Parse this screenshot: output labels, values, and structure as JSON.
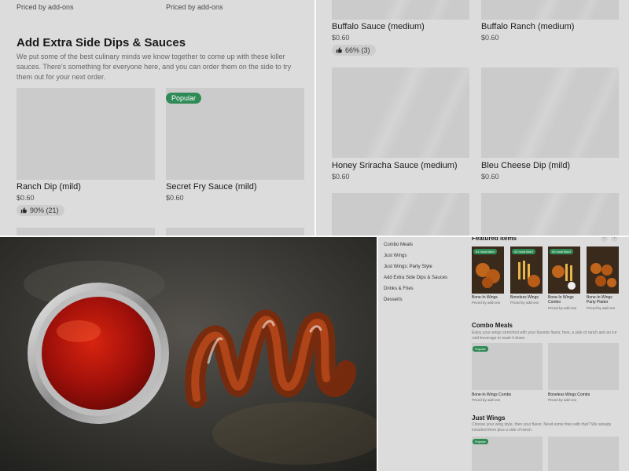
{
  "top_left": {
    "prev_items": [
      {
        "price": "Priced by add-ons"
      },
      {
        "price": "Priced by add-ons"
      }
    ],
    "section_title": "Add Extra Side Dips & Sauces",
    "section_desc": "We put some of the best culinary minds we know together to come up with these killer sauces. There's something for everyone here, and you can order them on the side to try them out for your next order.",
    "items": [
      {
        "name": "Ranch Dip (mild)",
        "price": "$0.60",
        "rating": "90% (21)"
      },
      {
        "name": "Secret Fry Sauce (mild)",
        "price": "$0.60",
        "badge": "Popular"
      }
    ]
  },
  "top_right": {
    "items": [
      {
        "name": "Buffalo Sauce (medium)",
        "price": "$0.60",
        "rating": "66% (3)"
      },
      {
        "name": "Buffalo Ranch (medium)",
        "price": "$0.60"
      },
      {
        "name": "Honey Sriracha Sauce (medium)",
        "price": "$0.60"
      },
      {
        "name": "Bleu Cheese Dip (mild)",
        "price": "$0.60"
      }
    ]
  },
  "bottom_left": {
    "photo_subject": "sauce-cup-photo"
  },
  "bottom_right": {
    "nav": [
      "Combo Meals",
      "Just Wings",
      "Just Wings: Party Style",
      "Add Extra Side Dips & Sauces",
      "Drinks & Fries",
      "Desserts"
    ],
    "featured_title": "Featured items",
    "prev_arrow": "‹",
    "next_arrow": "›",
    "featured": [
      {
        "badge": "#1 most liked",
        "name": "Bone-In Wings",
        "price": "Priced by add-ons"
      },
      {
        "badge": "#2 most liked",
        "name": "Boneless Wings",
        "price": "Priced by add-ons"
      },
      {
        "badge": "#3 most liked",
        "name": "Bone-In Wings Combo",
        "price": "Priced by add-ons"
      },
      {
        "badge": "",
        "name": "Bone-In Wings Party Platter",
        "price": "Priced by add-ons"
      }
    ],
    "combo_title": "Combo Meals",
    "combo_desc": "Enjoy your wings stretched with your favorite flavor, fries, a side of ranch and an ice cold beverage to wash it down.",
    "combo_items": [
      {
        "badge": "Popular",
        "name": "Bone-In Wings Combo",
        "price": "Priced by add-ons"
      },
      {
        "name": "Boneless Wings Combo",
        "price": "Priced by add-ons"
      }
    ],
    "wings_title": "Just Wings",
    "wings_desc": "Choose your wing style, then your flavor. Need some fries with that? We already included them plus a side of ranch.",
    "wings_badge": "Popular"
  },
  "colors": {
    "popular_badge": "#2f8a55",
    "panel_bg": "#dcdcdc"
  }
}
